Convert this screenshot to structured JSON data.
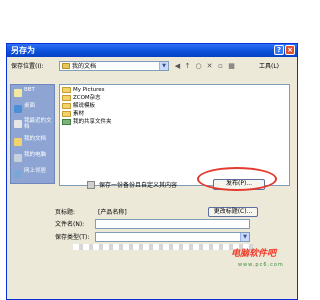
{
  "dialog": {
    "title": "另存为",
    "help_glyph": "?",
    "close_glyph": "×"
  },
  "location": {
    "label": "保存位置(I):",
    "value": "我的文档"
  },
  "toolbar": {
    "tools_label": "工具(L)"
  },
  "places": [
    {
      "label": "BBT",
      "icon": "recent-icon"
    },
    {
      "label": "桌面",
      "icon": "desktop-icon"
    },
    {
      "label": "我最近的文档",
      "icon": "recent-docs-icon"
    },
    {
      "label": "我的文档",
      "icon": "my-documents-icon"
    },
    {
      "label": "我的电脑",
      "icon": "my-computer-icon"
    },
    {
      "label": "网上邻居",
      "icon": "network-icon"
    }
  ],
  "files": [
    {
      "label": "My Pictures",
      "shared": false
    },
    {
      "label": "ZCOM杂志",
      "shared": false
    },
    {
      "label": "解说模板",
      "shared": false
    },
    {
      "label": "素材",
      "shared": false
    },
    {
      "label": "我的共享文件夹",
      "shared": true
    }
  ],
  "backup": {
    "label": "保存一份备份且自定义其内容"
  },
  "buttons": {
    "publish": "发布(P)...",
    "change_title": "更改标题(C)..."
  },
  "form": {
    "page_title_label": "页标题:",
    "page_title_value": "[产品名称]",
    "filename_label": "文件名(N):",
    "savetype_label": "保存类型(T):"
  },
  "watermark": {
    "text": "电脑软件吧",
    "url": "www.pc6.com"
  }
}
